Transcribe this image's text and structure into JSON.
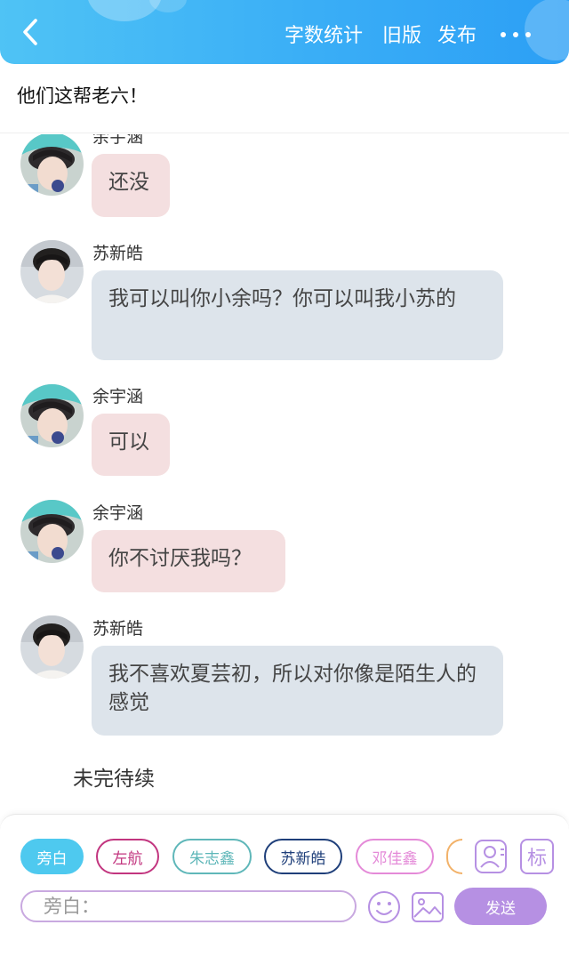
{
  "header": {
    "back_icon": "chevron-left-icon",
    "word_count": "字数统计",
    "old_version": "旧版",
    "publish": "发布",
    "more_icon": "more-horizontal-icon",
    "colors": {
      "gradient_start": "#4fc3f5",
      "gradient_end": "#2c9ff5"
    }
  },
  "story": {
    "title": "他们这帮老六！"
  },
  "chat": {
    "messages": [
      {
        "sender": "余宇涵",
        "text": "还没",
        "style": "pink"
      },
      {
        "sender": "苏新皓",
        "text": "我可以叫你小余吗？你可以叫我小苏的",
        "style": "gray"
      },
      {
        "sender": "余宇涵",
        "text": "可以",
        "style": "pink"
      },
      {
        "sender": "余宇涵",
        "text": "你不讨厌我吗？",
        "style": "pink"
      },
      {
        "sender": "苏新皓",
        "text": "我不喜欢夏芸初，所以对你像是陌生人的感觉",
        "style": "gray"
      }
    ],
    "to_be_continued": "未完待续",
    "colors": {
      "pink_bubble": "#f4dfe0",
      "gray_bubble": "#dde4eb"
    }
  },
  "composer": {
    "roles": [
      {
        "label": "旁白",
        "color": "#4ec9ef",
        "active": true
      },
      {
        "label": "左航",
        "color": "#c2357f",
        "active": false
      },
      {
        "label": "朱志鑫",
        "color": "#5fb7b9",
        "active": false
      },
      {
        "label": "苏新皓",
        "color": "#1f3f7a",
        "active": false
      },
      {
        "label": "邓佳鑫",
        "color": "#e48ad8",
        "active": false
      }
    ],
    "role_icon": "contact-card-icon",
    "tag_label": "标",
    "input_placeholder": "旁白：",
    "emoji_icon": "smiley-icon",
    "image_icon": "image-icon",
    "send": "发送",
    "colors": {
      "accent": "#b690e3"
    }
  }
}
